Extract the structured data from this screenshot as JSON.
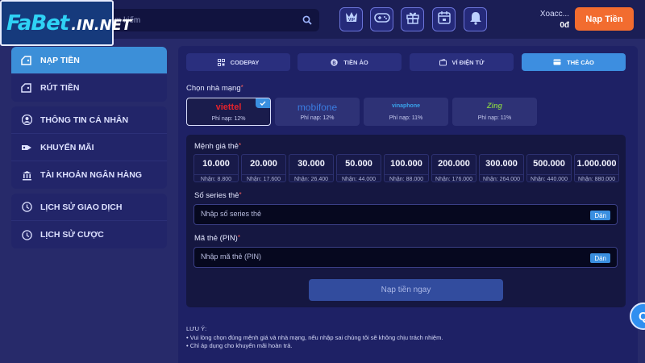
{
  "logo": {
    "brand": "FABET",
    "domain": ".IN.NET",
    "text": "FaBet.IN.NET"
  },
  "search": {
    "placeholder": "m kiếm"
  },
  "header_icons": [
    "vip-icon",
    "gamepad-icon",
    "gift-icon",
    "calendar-icon",
    "bell-icon"
  ],
  "vip_text": "VIP",
  "user": {
    "name": "Xoacc...",
    "balance": "0đ"
  },
  "deposit_button": "Nạp Tiền",
  "sidebar": {
    "group1": [
      {
        "label": "NẠP TIỀN",
        "icon": "wallet-in-icon",
        "active": true
      },
      {
        "label": "RÚT TIỀN",
        "icon": "wallet-out-icon"
      }
    ],
    "group2": [
      {
        "label": "THÔNG TIN CÁ NHÂN",
        "icon": "user-icon"
      },
      {
        "label": "KHUYẾN MÃI",
        "icon": "promo-icon"
      },
      {
        "label": "TÀI KHOẢN NGÂN HÀNG",
        "icon": "bank-icon"
      }
    ],
    "group3": [
      {
        "label": "LỊCH SỬ GIAO DỊCH",
        "icon": "history-icon"
      },
      {
        "label": "LỊCH SỬ CƯỢC",
        "icon": "bet-history-icon"
      }
    ]
  },
  "tabs": [
    {
      "label": "CODEPAY",
      "icon": "qr-icon"
    },
    {
      "label": "TIỀN ẢO",
      "icon": "bitcoin-icon"
    },
    {
      "label": "VÍ ĐIỆN TỬ",
      "icon": "ewallet-icon"
    },
    {
      "label": "THẺ CÀO",
      "icon": "card-icon",
      "active": true
    }
  ],
  "network_label": "Chọn nhà mạng",
  "networks": [
    {
      "name": "viettel",
      "fee": "Phí nạp: 12%",
      "color": "#e4232c",
      "selected": true
    },
    {
      "name": "mobifone",
      "fee": "Phí nạp: 12%",
      "color": "#1f5fb8"
    },
    {
      "name": "vinaphone",
      "fee": "Phí nạp: 11%",
      "color": "#2a9be0"
    },
    {
      "name": "Zing",
      "fee": "Phí nạp: 11%",
      "color": "#7fc24a"
    }
  ],
  "denomination_label": "Mệnh giá thẻ",
  "denominations": [
    {
      "value": "10.000",
      "receive": "Nhận: 8.800"
    },
    {
      "value": "20.000",
      "receive": "Nhận: 17.600"
    },
    {
      "value": "30.000",
      "receive": "Nhận: 26.400"
    },
    {
      "value": "50.000",
      "receive": "Nhận: 44.000"
    },
    {
      "value": "100.000",
      "receive": "Nhận: 88.000"
    },
    {
      "value": "200.000",
      "receive": "Nhận: 176.000"
    },
    {
      "value": "300.000",
      "receive": "Nhận: 264.000"
    },
    {
      "value": "500.000",
      "receive": "Nhận: 440.000"
    },
    {
      "value": "1.000.000",
      "receive": "Nhận: 880.000"
    }
  ],
  "serial": {
    "label": "Số series thẻ",
    "placeholder": "Nhập số series thẻ",
    "paste": "Dán"
  },
  "pin": {
    "label": "Mã thẻ (PIN)",
    "placeholder": "Nhập mã thẻ (PIN)",
    "paste": "Dán"
  },
  "submit_label": "Nạp tiền ngay",
  "notes": {
    "title": "LƯU Ý:",
    "items": [
      "Vui lòng chọn đúng mệnh giá và nhà mạng, nếu nhập sai chúng tôi sẽ không chịu trách nhiệm.",
      "Chỉ áp dụng cho khuyến mãi hoàn trả."
    ]
  },
  "chat_glyph": "Q"
}
